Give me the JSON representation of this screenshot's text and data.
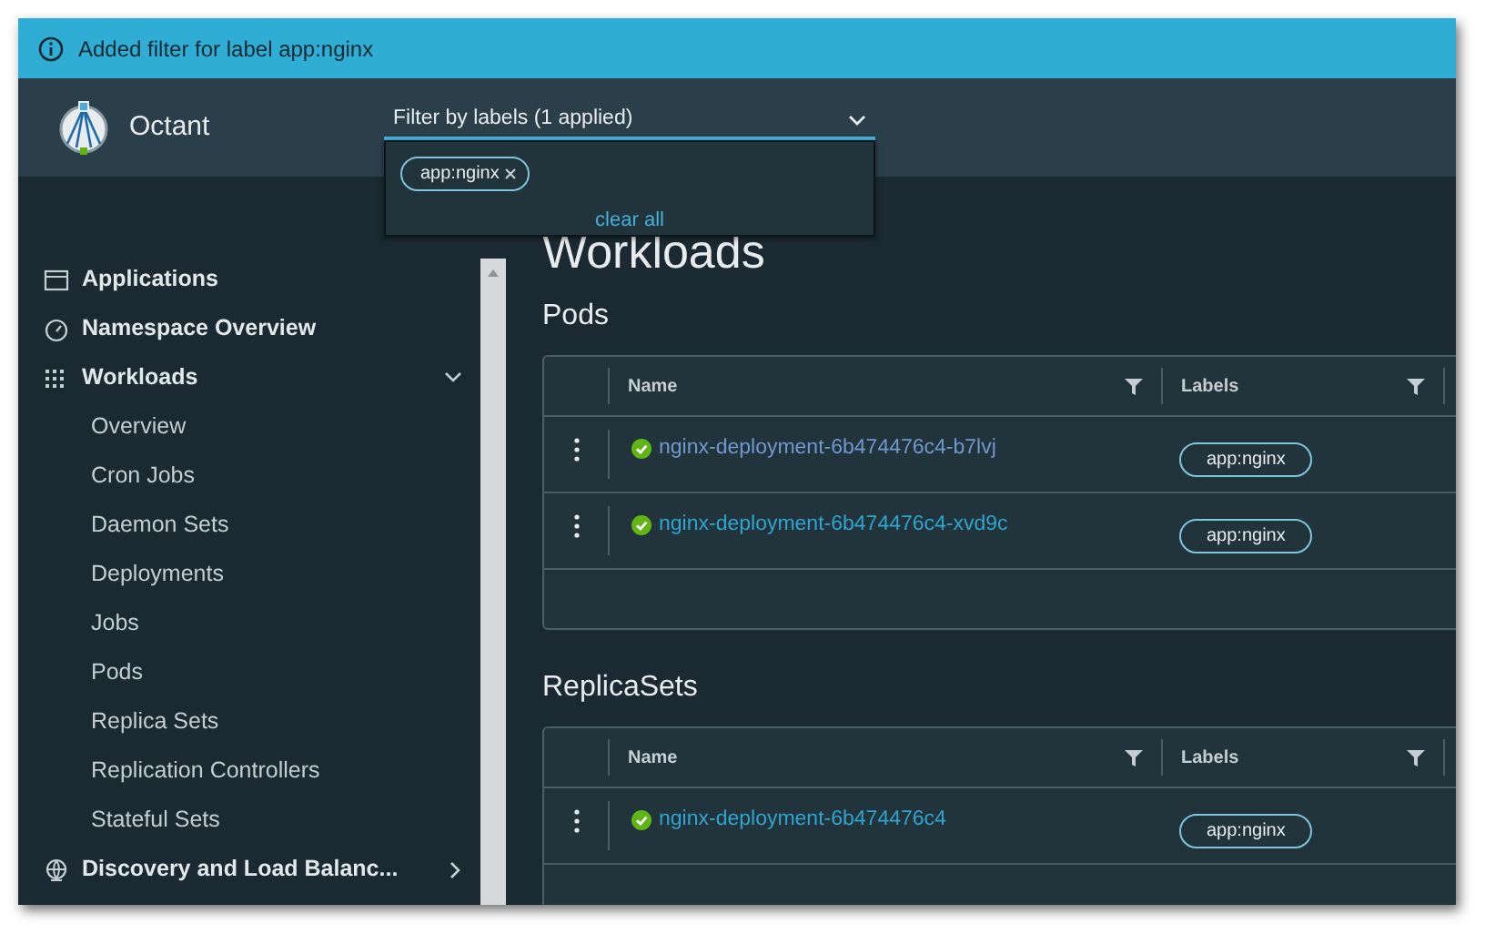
{
  "banner": {
    "message": "Added filter for label app:nginx"
  },
  "header": {
    "app_name": "Octant",
    "filter": {
      "label": "Filter by labels (1 applied)",
      "expanded": true,
      "applied": [
        {
          "label": "app:nginx"
        }
      ],
      "clear_all": "clear all"
    }
  },
  "sidebar": {
    "items": [
      {
        "label": "Applications"
      },
      {
        "label": "Namespace Overview"
      },
      {
        "label": "Workloads",
        "expanded": true,
        "children": [
          {
            "label": "Overview"
          },
          {
            "label": "Cron Jobs"
          },
          {
            "label": "Daemon Sets"
          },
          {
            "label": "Deployments"
          },
          {
            "label": "Jobs"
          },
          {
            "label": "Pods"
          },
          {
            "label": "Replica Sets"
          },
          {
            "label": "Replication Controllers"
          },
          {
            "label": "Stateful Sets"
          }
        ]
      },
      {
        "label": "Discovery and Load Balanc...",
        "expanded": false
      }
    ]
  },
  "page_title": "Workloads",
  "sections": [
    {
      "title": "Pods",
      "columns": [
        "Name",
        "Labels"
      ],
      "rows": [
        {
          "name": "nginx-deployment-6b474476c4-b7lvj",
          "hovered": true,
          "labels": [
            "app:nginx"
          ]
        },
        {
          "name": "nginx-deployment-6b474476c4-xvd9c",
          "hovered": false,
          "labels": [
            "app:nginx"
          ]
        }
      ]
    },
    {
      "title": "ReplicaSets",
      "columns": [
        "Name",
        "Labels"
      ],
      "rows": [
        {
          "name": "nginx-deployment-6b474476c4",
          "hovered": false,
          "labels": [
            "app:nginx"
          ]
        }
      ]
    }
  ]
}
